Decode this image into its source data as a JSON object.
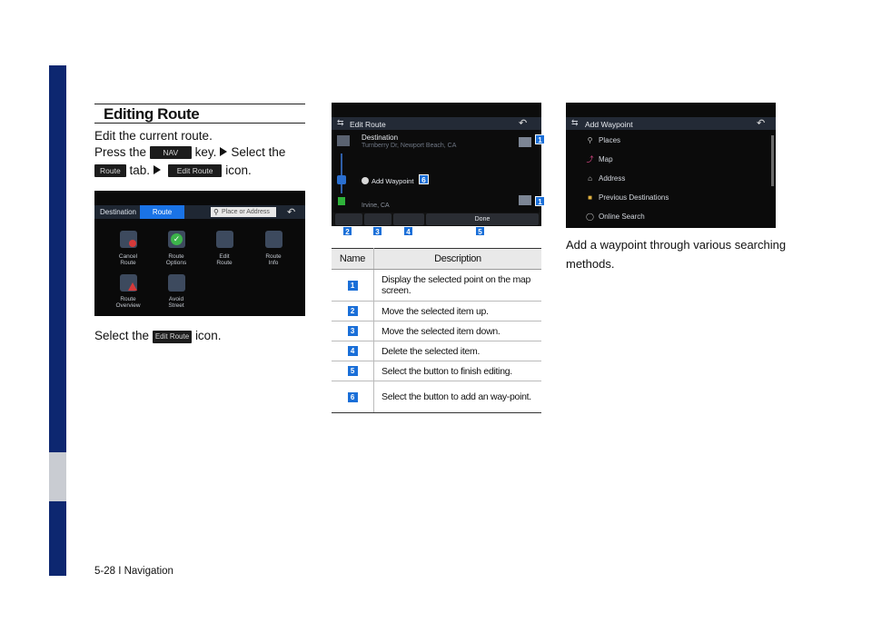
{
  "page": {
    "footer": "5-28 I Navigation"
  },
  "column1": {
    "title": "Editing Route",
    "intro": "Edit the current route.",
    "press_the": "Press the",
    "nav_key": "NAV",
    "key_select_the": "key.",
    "select_the": "Select the",
    "route_key": "Route",
    "tab_text": "tab.",
    "edit_route_key": "Edit Route",
    "icon_text": "icon.",
    "select_line_prefix": "Select the",
    "select_line_key": "Edit Route",
    "select_line_suffix": "icon."
  },
  "screen1": {
    "tabs": [
      "Destination",
      "Route"
    ],
    "search_placeholder": "Place or Address",
    "items": [
      {
        "label1": "Cancel",
        "label2": "Route"
      },
      {
        "label1": "Route",
        "label2": "Options"
      },
      {
        "label1": "Edit",
        "label2": "Route"
      },
      {
        "label1": "Route",
        "label2": "Info"
      },
      {
        "label1": "Route",
        "label2": "Overview"
      },
      {
        "label1": "Avoid",
        "label2": "Street"
      }
    ]
  },
  "screen2": {
    "title": "Edit Route",
    "destination_label": "Destination",
    "destination_address": "Turnberry Dr, Newport Beach, CA",
    "add_waypoint": "Add Waypoint",
    "origin_city": "Irvine, CA",
    "done_label": "Done",
    "callouts": [
      "1",
      "1",
      "2",
      "3",
      "4",
      "5",
      "6"
    ]
  },
  "table": {
    "headers": [
      "Name",
      "Description"
    ],
    "rows": [
      {
        "num": "1",
        "desc": "Display the selected point on the map screen."
      },
      {
        "num": "2",
        "desc": "Move the selected item up."
      },
      {
        "num": "3",
        "desc": "Move the selected item down."
      },
      {
        "num": "4",
        "desc": "Delete the selected item."
      },
      {
        "num": "5",
        "desc": "Select the button to finish editing."
      },
      {
        "num": "6",
        "desc": "Select the button to add an way-point."
      }
    ]
  },
  "screen3": {
    "title": "Add Waypoint",
    "items": [
      "Places",
      "Map",
      "Address",
      "Previous Destinations",
      "Online Search"
    ]
  },
  "column3": {
    "line1": "Add a waypoint through various searching",
    "line2": "methods."
  }
}
